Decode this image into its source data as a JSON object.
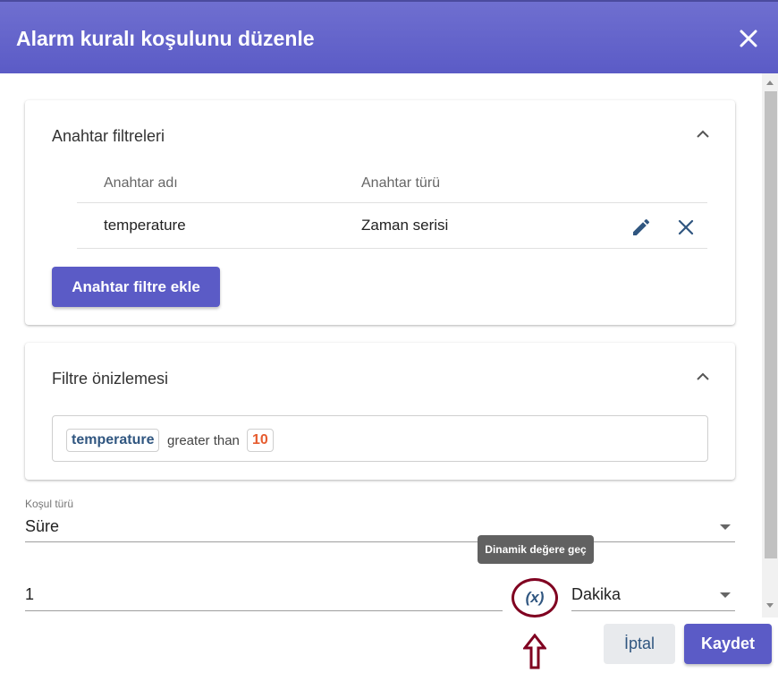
{
  "dialog": {
    "title": "Alarm kuralı koşulunu düzenle"
  },
  "key_filters": {
    "title": "Anahtar filtreleri",
    "columns": {
      "key_name": "Anahtar adı",
      "key_type": "Anahtar türü"
    },
    "rows": [
      {
        "key_name": "temperature",
        "key_type": "Zaman serisi"
      }
    ],
    "add_button": "Anahtar filtre ekle"
  },
  "filter_preview": {
    "title": "Filtre önizlemesi",
    "key": "temperature",
    "operator": "greater than",
    "value": "10"
  },
  "condition": {
    "type_label": "Koşul türü",
    "type_value": "Süre",
    "duration_value": "1",
    "tooltip": "Dinamik değere geç",
    "dynamic_toggle": "(x)",
    "unit_value": "Dakika"
  },
  "footer": {
    "cancel": "İptal",
    "save": "Kaydet"
  },
  "colors": {
    "header": "#5b5bc6",
    "accent": "#5b5bc6",
    "key_chip": "#305680",
    "value_chip": "#e65c2f",
    "annotation": "#800020"
  },
  "icons": {
    "close": "close-icon",
    "collapse": "chevron-up-icon",
    "edit": "pencil-icon",
    "delete": "close-icon",
    "dropdown": "caret-down-icon",
    "annotation": "arrow-up-icon"
  }
}
